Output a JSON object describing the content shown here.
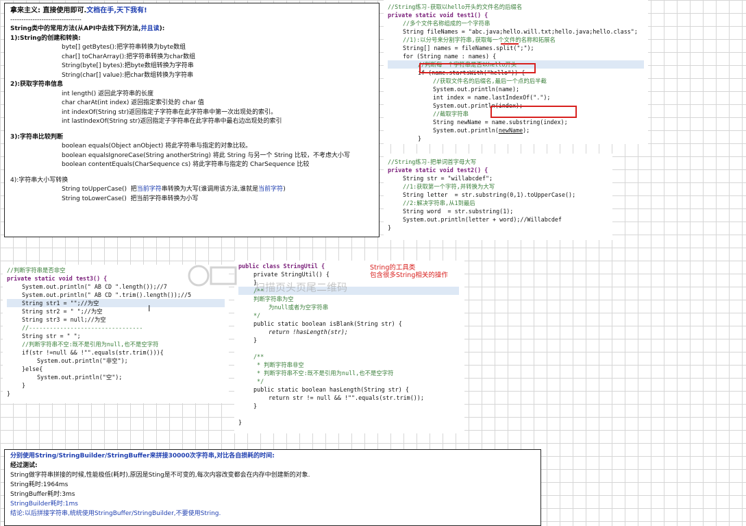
{
  "notes": {
    "title": "拿来主义: 直接使用即可.",
    "title_blue": "文档在手,天下我有!",
    "divider": "--------------------------------",
    "intro": "String类中的常用方法(从API中去找下列方法,",
    "intro_blue": "并且读",
    "intro_end": "):",
    "s1": "1):String的创建和转换:",
    "s1_items": [
      "byte[] getBytes():把字符串转换为byte数组",
      "char[] toCharArray():把字符串转换为char数组",
      "String(byte[] bytes):把byte数组转换为字符串",
      "String(char[] value):把char数组转换为字符串"
    ],
    "s2": "2):获取字符串信息",
    "s2_items": [
      "int length() 返回此字符串的长度",
      "char charAt(int index) 返回指定索引处的 char 值",
      "int indexOf(String str)返回指定子字符串在此字符串中第一次出现处的索引。",
      "int lastIndexOf(String str)返回指定子字符串在此字符串中最右边出现处的索引"
    ],
    "s3": "3):字符串比较判断",
    "s3_items": [
      "boolean equals(Object anObject) 将此字符串与指定的对象比较。",
      "boolean equalsIgnoreCase(String anotherString) 将此 String 与另一个 String 比较，不考虑大小写",
      "boolean contentEquals(CharSequence cs) 将此字符串与指定的 CharSequence 比较"
    ],
    "s4": "4):字符串大小写转换",
    "s4_upper_a": "String toUpperCase()  把",
    "s4_upper_b": "当前字符",
    "s4_upper_c": "串转换为大写(谁调用该方法,谁就是",
    "s4_upper_d": "当前字符",
    "s4_upper_e": ")",
    "s4_lower": "String toLowerCase()  把当前字符串转换为小写"
  },
  "code1": {
    "comment": "//String练习-获取以hello开头的文件名的后缀名",
    "sig": "private static void test1() {",
    "c1": "//多个文件名称组成的一个字符串",
    "fn": "String fileNames = \"abc.java;hello.will.txt;hello.java;hello.class\";",
    "c2": "//1):以分号来分割字符串,获取每一个文件的名称和拓展名",
    "split": "String[] names = fileNames.split(\";\");",
    "for": "for (String name : names) {",
    "c3": "//判断每一个字符串是否以hello开头",
    "if": "if (name.startsWith(\"hello\")) {",
    "c4": "//获取文件名的后缀名,最后一个点的后半截",
    "p1": "System.out.println(name);",
    "idx": "int index = name.lastIndexOf(\".\");",
    "p2": "System.out.println(index);",
    "c5": "//截取字符串",
    "nn_a": "String newName = ",
    "nn_b": "name.substring(index);",
    "p3_a": "System.out.println(",
    "p3_b": "newName",
    "p3_c": ");",
    "close": "}"
  },
  "code2": {
    "comment": "//String练习-把单词首字母大写",
    "sig": "private static void test2() {",
    "s": "String str = \"willabcdef\";",
    "c1": "//1:获取第一个字符,并转换为大写",
    "l": "String letter  = str.substring(0,1).toUpperCase();",
    "c2": "//2:解决字符串,从1到最后",
    "w": "String word  = str.substring(1);",
    "p": "System.out.println(letter + word);//Willabcdef",
    "close": "}"
  },
  "code3": {
    "comment": "//判断字符串是否非空",
    "sig": "private static void test3() {",
    "l1": "System.out.println(\" AB CD \".length());//7",
    "l2": "System.out.println(\" AB CD \".trim().length());//5",
    "l3": "String str1 = \"\";//为空",
    "l4": "String str2 = \" \";//为空",
    "l5": "String str3 = null;//为空",
    "div": "//---------------------------------",
    "l6": "String str = \" \";",
    "c1": "//判断字符串不空:既不是引用为null,也不是空字符",
    "if": "if(str !=null && !\"\".equals(str.trim())){",
    "p1": "System.out.println(\"非空\");",
    "else": "}else{",
    "p2": "System.out.println(\"空\");",
    "close1": "}",
    "close2": "}"
  },
  "code4": {
    "cls": "public class StringUtil {",
    "ctor": "private StringUtil() {",
    "close": "}",
    "jd1": "/**",
    "jd2": "判断字符串为空",
    "jd3": "为null或者为空字符串",
    "jd4": "*/",
    "m1": "public static boolean isBlank(String str) {",
    "r1": "return !hasLength(str);",
    "jd5": "/**",
    "jd6": " * 判断字符串非空",
    "jd7": " * 判断字符串不空:既不是引用为null,也不是空字符",
    "jd8": " */",
    "m2": "public static boolean hasLength(String str) {",
    "r2": "return str != null && !\"\".equals(str.trim());",
    "end": "}"
  },
  "redlabel": [
    "String的工具类",
    "包含很多String相关的操作"
  ],
  "watermark": "扫描页头页尾二维码",
  "summary": {
    "heading": "分别使用String/StringBuilder/StringBuffer来拼接30000次字符串,对比各自损耗的时间:",
    "test": "经过测试:",
    "desc": "String做字符串拼接的时候,性能极低(耗时),原因是Sting是不可变的,每次内容改变都会在内存中创建新的对象.",
    "t1": "String耗时:1964ms",
    "t2": "StringBuffer耗时:3ms",
    "t3": "StringBuilder耗时:1ms",
    "conclusion": "结论:以后拼接字符串,统统使用StringBuffer/StringBuilder,不要使用String."
  },
  "colors": {
    "red": "#d8201e",
    "blue": "#1f3fb0",
    "comment": "#3a7f3a",
    "keyword": "#7a1f7a"
  }
}
